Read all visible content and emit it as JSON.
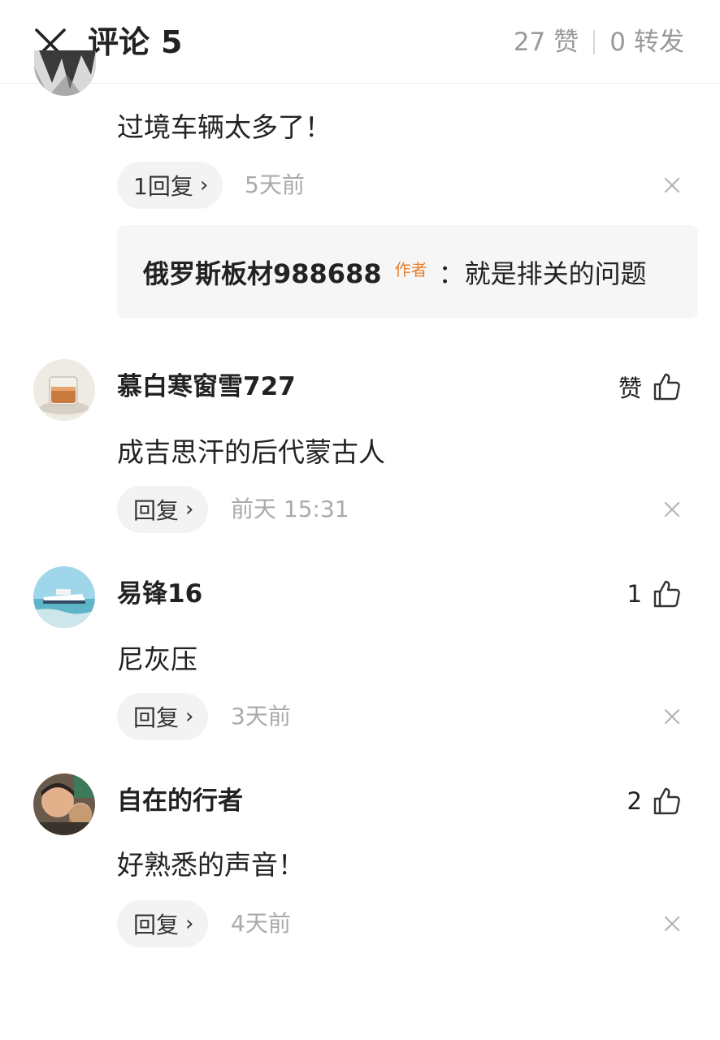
{
  "header": {
    "title": "评论",
    "comment_count": "5",
    "likes_count": "27",
    "likes_label": "赞",
    "forwards_count": "0",
    "forwards_label": "转发"
  },
  "comments": [
    {
      "text": "过境车辆太多了！",
      "reply_label": "1回复",
      "time": "5天前",
      "sub_reply": {
        "username": "俄罗斯板材988688",
        "tag": "作者",
        "text": "：就是排关的问题"
      }
    },
    {
      "username": "慕白寒窗雪727",
      "like_label": "赞",
      "text": "成吉思汗的后代蒙古人",
      "reply_label": "回复",
      "time": "前天 15:31"
    },
    {
      "username": "易锋16",
      "like_label": "1",
      "text": "尼灰压",
      "reply_label": "回复",
      "time": "3天前"
    },
    {
      "username": "自在的行者",
      "like_label": "2",
      "text": "好熟悉的声音！",
      "reply_label": "回复",
      "time": "4天前"
    }
  ]
}
